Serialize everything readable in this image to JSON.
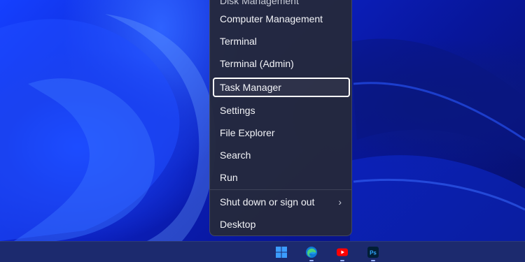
{
  "menu": {
    "partial_top_label": "Disk Management",
    "items": [
      {
        "label": "Computer Management",
        "focused": false
      },
      {
        "label": "Terminal",
        "focused": false
      },
      {
        "label": "Terminal (Admin)",
        "focused": false
      },
      {
        "label": "Task Manager",
        "focused": true
      },
      {
        "label": "Settings",
        "focused": false
      },
      {
        "label": "File Explorer",
        "focused": false
      },
      {
        "label": "Search",
        "focused": false
      },
      {
        "label": "Run",
        "focused": false
      },
      {
        "label": "Shut down or sign out",
        "focused": false,
        "has_submenu": true
      },
      {
        "label": "Desktop",
        "focused": false
      }
    ],
    "submenu_glyph": "›"
  },
  "taskbar": {
    "icons": [
      {
        "name": "windows-start-icon"
      },
      {
        "name": "edge-browser-icon"
      },
      {
        "name": "youtube-icon"
      },
      {
        "name": "photoshop-icon",
        "text": "Ps"
      }
    ]
  },
  "colors": {
    "menu_bg": "#24293c",
    "focus_border": "#ffffff",
    "taskbar_bg": "#1c2a6e",
    "windows_blue": "#3b9cff",
    "youtube_red": "#ff0000",
    "photoshop_bg": "#001e36",
    "photoshop_text": "#31a8ff"
  }
}
